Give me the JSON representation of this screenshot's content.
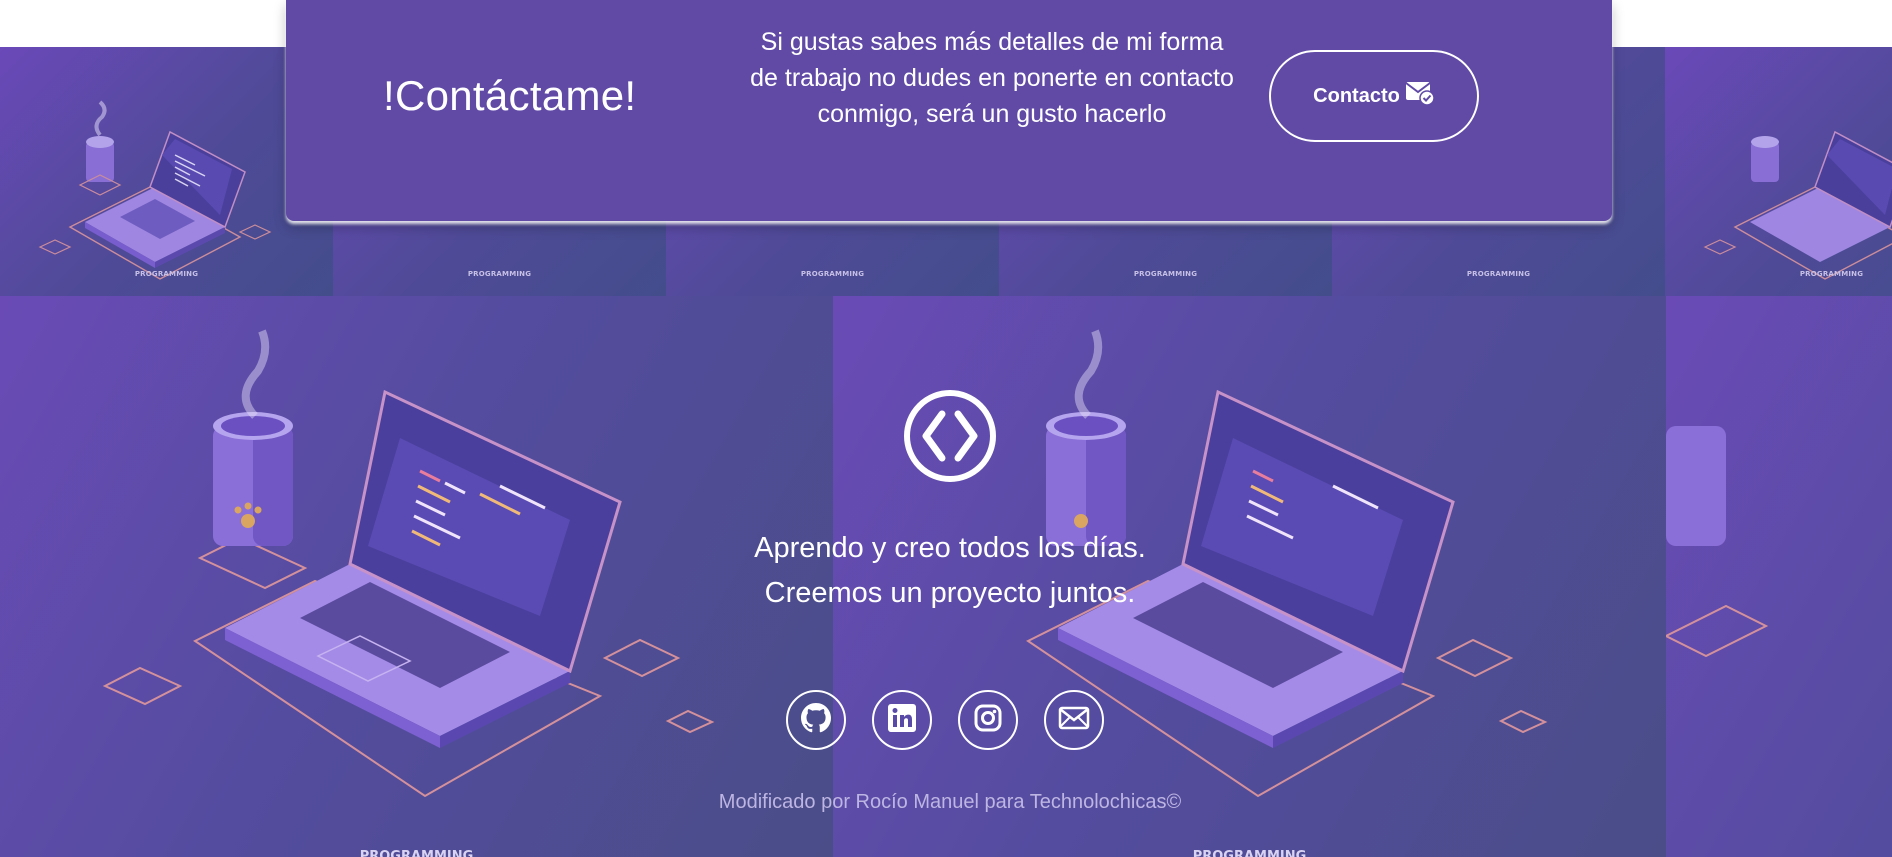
{
  "contact_banner": {
    "title": "!Contáctame!",
    "description": "Si gustas sabes más detalles de mi forma de trabajo no dudes en ponerte en contacto conmigo, será un gusto hacerlo",
    "contact_button_label": "Contacto",
    "contact_button_icon": "envelope-check-icon"
  },
  "background": {
    "small_tile_label": "PROGRAMMING",
    "big_tile_label": "PROGRAMMING"
  },
  "footer": {
    "logo_icon": "code-brackets-icon",
    "tagline_line1": "Aprendo y creo todos los días.",
    "tagline_line2": "Creemos un proyecto juntos.",
    "socials": [
      {
        "name": "GitHub",
        "icon": "github-icon"
      },
      {
        "name": "LinkedIn",
        "icon": "linkedin-icon"
      },
      {
        "name": "Instagram",
        "icon": "instagram-icon"
      },
      {
        "name": "Email",
        "icon": "mail-icon"
      }
    ],
    "credit": "Modificado por Rocío Manuel para Technolochicas©"
  },
  "colors": {
    "banner": "#604aa6",
    "background_purple": "#5a4aa8",
    "text": "#ffffff",
    "credit_text": "#bdb5e2"
  }
}
